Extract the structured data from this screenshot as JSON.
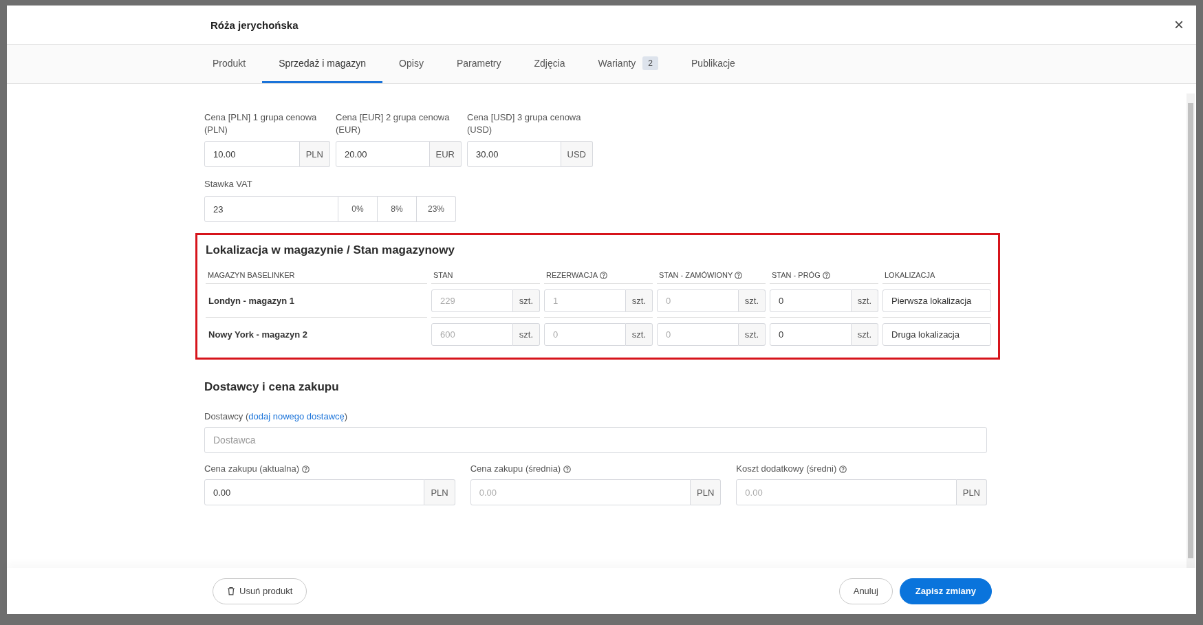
{
  "dialog": {
    "title": "Róża jerychońska",
    "close": "×"
  },
  "tabs": [
    {
      "label": "Produkt",
      "selected": false
    },
    {
      "label": "Sprzedaż i magazyn",
      "selected": true
    },
    {
      "label": "Opisy",
      "selected": false
    },
    {
      "label": "Parametry",
      "selected": false
    },
    {
      "label": "Zdjęcia",
      "selected": false
    },
    {
      "label": "Warianty",
      "selected": false,
      "badge": "2"
    },
    {
      "label": "Publikacje",
      "selected": false
    }
  ],
  "prices": [
    {
      "label": "Cena [PLN] 1 grupa cenowa (PLN)",
      "value": "10.00",
      "unit": "PLN"
    },
    {
      "label": "Cena [EUR] 2 grupa cenowa (EUR)",
      "value": "20.00",
      "unit": "EUR"
    },
    {
      "label": "Cena [USD] 3 grupa cenowa (USD)",
      "value": "30.00",
      "unit": "USD"
    }
  ],
  "vat": {
    "label": "Stawka VAT",
    "value": "23",
    "options": [
      "0%",
      "8%",
      "23%"
    ]
  },
  "warehouse": {
    "title": "Lokalizacja w magazynie / Stan magazynowy",
    "highlighted": true,
    "columns": [
      {
        "label": "MAGAZYN BASELINKER",
        "help": false
      },
      {
        "label": "STAN",
        "help": false
      },
      {
        "label": "REZERWACJA",
        "help": true
      },
      {
        "label": "STAN - ZAMÓWIONY",
        "help": true
      },
      {
        "label": "STAN - PRÓG",
        "help": true
      },
      {
        "label": "LOKALIZACJA",
        "help": false
      }
    ],
    "rows": [
      {
        "cells": [
          {
            "kind": "name",
            "value": "Londyn - magazyn 1"
          },
          {
            "kind": "quantity",
            "value": "229",
            "unit": "szt.",
            "disabled": true
          },
          {
            "kind": "quantity",
            "value": "1",
            "unit": "szt.",
            "disabled": true
          },
          {
            "kind": "quantity",
            "value": "0",
            "unit": "szt.",
            "disabled": true
          },
          {
            "kind": "quantity",
            "value": "0",
            "unit": "szt.",
            "disabled": false
          },
          {
            "kind": "location",
            "value": "Pierwsza lokalizacja"
          }
        ]
      },
      {
        "cells": [
          {
            "kind": "name",
            "value": "Nowy York - magazyn 2"
          },
          {
            "kind": "quantity",
            "value": "600",
            "unit": "szt.",
            "disabled": true
          },
          {
            "kind": "quantity",
            "value": "0",
            "unit": "szt.",
            "disabled": true
          },
          {
            "kind": "quantity",
            "value": "0",
            "unit": "szt.",
            "disabled": true
          },
          {
            "kind": "quantity",
            "value": "0",
            "unit": "szt.",
            "disabled": false
          },
          {
            "kind": "location",
            "value": "Druga lokalizacja"
          }
        ]
      }
    ]
  },
  "suppliers": {
    "title": "Dostawcy i cena zakupu",
    "label": "Dostawcy (",
    "link": "dodaj nowego dostawcę",
    "label_end": ")",
    "placeholder": "Dostawca",
    "costs": [
      {
        "label": "Cena zakupu (aktualna)",
        "help": true,
        "value": "0.00",
        "unit": "PLN",
        "disabled": false
      },
      {
        "label": "Cena zakupu (średnia)",
        "help": true,
        "value": "0.00",
        "unit": "PLN",
        "disabled": true
      },
      {
        "label": "Koszt dodatkowy (średni)",
        "help": true,
        "value": "0.00",
        "unit": "PLN",
        "disabled": true
      }
    ]
  },
  "footer": {
    "delete": "Usuń produkt",
    "cancel": "Anuluj",
    "save": "Zapisz zmiany"
  }
}
